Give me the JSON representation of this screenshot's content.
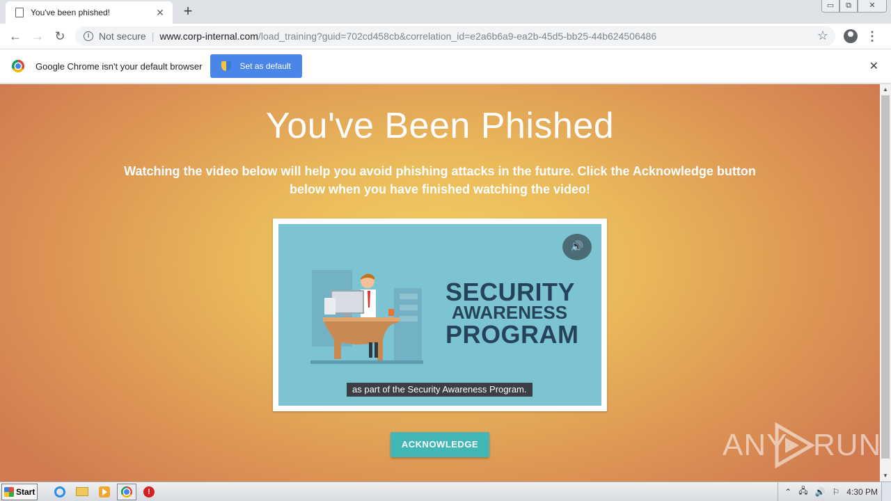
{
  "browser": {
    "tab_title": "You've been phished!",
    "tab_close": "✕",
    "new_tab": "+",
    "window_controls": [
      "▭",
      "⧉",
      "✕"
    ],
    "nav": {
      "back": "←",
      "forward": "→",
      "reload": "↻"
    },
    "security_label": "Not secure",
    "url_host": "www.corp-internal.com",
    "url_path": "/load_training?guid=702cd458cb&correlation_id=e2a6b6a9-ea2b-45d5-bb25-44b624506486",
    "bookmark_star": "☆",
    "menu": "⋮"
  },
  "infobar": {
    "message": "Google Chrome isn't your default browser",
    "button_label": "Set as default",
    "close": "✕"
  },
  "page": {
    "heading": "You've Been Phished",
    "instructions": "Watching the video below will help you avoid phishing attacks in the future. Click the Acknowledge button below when you have finished watching the video!",
    "video": {
      "title_line1": "SECURITY",
      "title_line2": "AWARENESS",
      "title_line3": "PROGRAM",
      "caption": "as part of the Security Awareness Program.",
      "sound_icon": "🔊"
    },
    "acknowledge_label": "ACKNOWLEDGE",
    "watermark_left": "ANY",
    "watermark_right": "RUN"
  },
  "scrollbar": {
    "up": "▲",
    "down": "▼"
  },
  "taskbar": {
    "start_label": "Start",
    "tray_icons": [
      "⌃",
      "🖧",
      "🔊",
      "⚐"
    ],
    "clock": "4:30 PM"
  },
  "colors": {
    "accent_blue": "#4a86e8",
    "acknowledge_teal": "#43b6b6",
    "video_bg": "#7dc4d2",
    "video_title": "#25435a"
  }
}
